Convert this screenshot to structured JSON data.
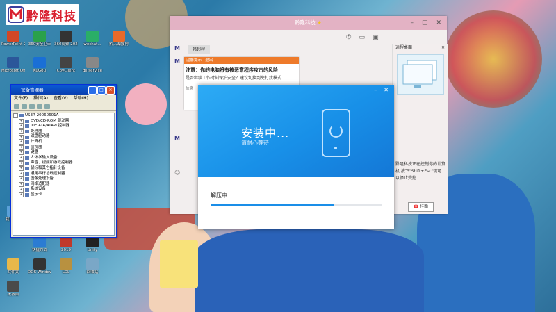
{
  "brand": {
    "logo_text": "黔隆科技",
    "logo_letter": "M",
    "accent": "#d9202f"
  },
  "desktop_icons": [
    {
      "label": "PowerPoint 2003",
      "icon": "ppt-icon",
      "color": "#d24726"
    },
    {
      "label": "360安全卫士",
      "icon": "shield-icon",
      "color": "#2aa14a"
    },
    {
      "label": "360视频 20201172...",
      "icon": "video-icon",
      "color": "#333333"
    },
    {
      "label": "wechat...",
      "icon": "wechat-icon",
      "color": "#2aae67"
    },
    {
      "label": "黔入湖搜狗",
      "icon": "sogou-icon",
      "color": "#e86a2a"
    },
    {
      "label": "Microsoft Office Wo...",
      "icon": "word-icon",
      "color": "#2b579a"
    },
    {
      "label": "KuGou",
      "icon": "kugou-icon",
      "color": "#1a6fd6"
    },
    {
      "label": "CovClient",
      "icon": "app-icon",
      "color": "#444444"
    },
    {
      "label": "dll service",
      "icon": "dll-icon",
      "color": "#888888"
    },
    {
      "label": "我的电脑",
      "icon": "computer-icon",
      "color": "#5aa0d8"
    },
    {
      "label": "快捷方式",
      "icon": "shortcut-icon",
      "color": "#2b7cd3"
    },
    {
      "label": "2019",
      "icon": "cad-icon",
      "color": "#c0392b"
    },
    {
      "label": "Unity",
      "icon": "unity-icon",
      "color": "#222222"
    },
    {
      "label": "文件夹",
      "icon": "folder-icon",
      "color": "#e8b84a"
    },
    {
      "label": "DOS Windows",
      "icon": "dos-icon",
      "color": "#333333"
    },
    {
      "label": "LOL",
      "icon": "game-icon",
      "color": "#b89140"
    },
    {
      "label": "回收站",
      "icon": "recycle-icon",
      "color": "#7aa7c7"
    },
    {
      "label": "无界面",
      "icon": "doc-icon",
      "color": "#4a4a4a"
    }
  ],
  "devmgr": {
    "title": "设备管理器",
    "menu": [
      "文件(F)",
      "操作(A)",
      "查看(V)",
      "帮助(H)"
    ],
    "root": "USER-20060601A",
    "nodes": [
      "DVD/CD-ROM 驱动器",
      "IDE ATA/ATAPI 控制器",
      "处理器",
      "磁盘驱动器",
      "计算机",
      "监视器",
      "键盘",
      "人体学输入设备",
      "声音、视频和游戏控制器",
      "鼠标和其它指针设备",
      "通用串行总线控制器",
      "图像处理设备",
      "网络适配器",
      "系统设备",
      "显示卡"
    ]
  },
  "chat": {
    "title": "黔隆科技",
    "peer_label": "韩超程",
    "side_header": "远程桌面",
    "side_note": "黔隆科技正在控制你的计算机 按下\"Shift+Esc\"键可以停止受控",
    "hangup": "挂断"
  },
  "warning": {
    "header": "温馨提示 · 退出",
    "line1": "注意：你的电脑将有被恶意程序攻击的风险",
    "line2": "是否继续工作时刻保护安全？建议切换到免打扰模式",
    "line3": "信息"
  },
  "installer": {
    "title": "安装中...",
    "subtitle": "请耐心等待",
    "status": "解压中...",
    "progress": 0.72
  }
}
